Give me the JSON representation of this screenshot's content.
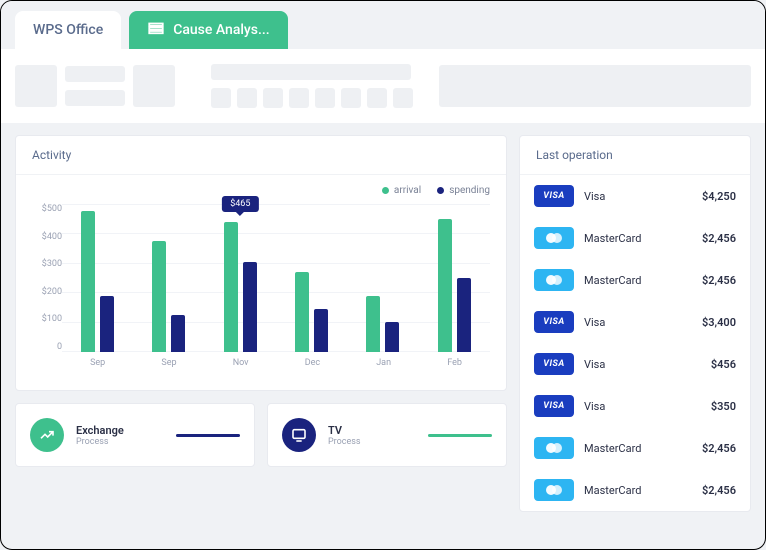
{
  "tabs": [
    {
      "label": "WPS Office",
      "active": true
    },
    {
      "label": "Cause Analys...",
      "icon": "sheet",
      "green": true
    }
  ],
  "activity": {
    "title": "Activity",
    "legend": {
      "arrival": "arrival",
      "spending": "spending"
    }
  },
  "chart_data": {
    "type": "bar",
    "categories": [
      "Sep",
      "Sep",
      "Nov",
      "Dec",
      "Jan",
      "Feb"
    ],
    "series": [
      {
        "name": "arrival",
        "values": [
          475,
          375,
          440,
          270,
          190,
          450
        ]
      },
      {
        "name": "spending",
        "values": [
          190,
          125,
          305,
          145,
          100,
          250
        ]
      }
    ],
    "ylabel": "",
    "xlabel": "",
    "ylim": [
      0,
      500
    ],
    "yticks": [
      "$500",
      "$400",
      "$300",
      "$200",
      "$100",
      "0"
    ],
    "highlight": {
      "index": 2,
      "series": 0,
      "label": "$465"
    },
    "colors": {
      "arrival": "#3ec08d",
      "spending": "#1a237e"
    }
  },
  "widgets": [
    {
      "icon": "trend",
      "title": "Exchange",
      "subtitle": "Process",
      "color": "g",
      "bar": "b"
    },
    {
      "icon": "monitor",
      "title": "TV",
      "subtitle": "Process",
      "color": "b",
      "bar": "t"
    }
  ],
  "last_operation": {
    "title": "Last operation",
    "rows": [
      {
        "brand": "visa",
        "name": "Visa",
        "amount": "$4,250"
      },
      {
        "brand": "mc",
        "name": "MasterCard",
        "amount": "$2,456"
      },
      {
        "brand": "mc",
        "name": "MasterCard",
        "amount": "$2,456"
      },
      {
        "brand": "visa",
        "name": "Visa",
        "amount": "$3,400"
      },
      {
        "brand": "visa",
        "name": "Visa",
        "amount": "$456"
      },
      {
        "brand": "visa",
        "name": "Visa",
        "amount": "$350"
      },
      {
        "brand": "mc",
        "name": "MasterCard",
        "amount": "$2,456"
      },
      {
        "brand": "mc",
        "name": "MasterCard",
        "amount": "$2,456"
      }
    ]
  },
  "visa_badge_text": "VISA"
}
